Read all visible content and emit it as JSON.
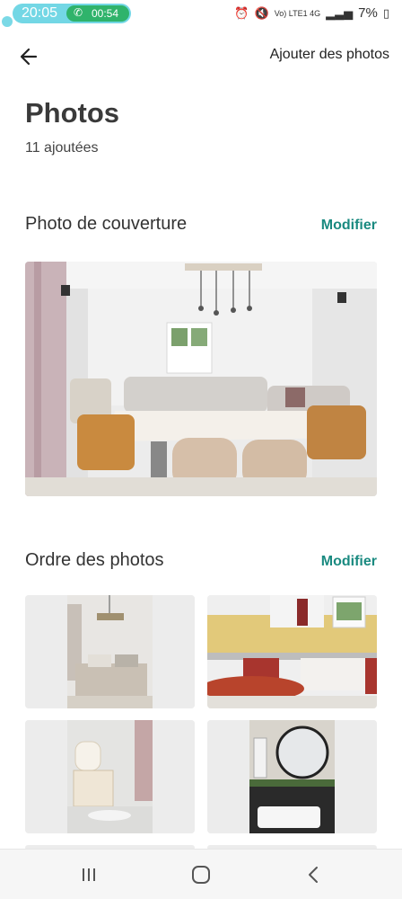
{
  "status_bar": {
    "time": "20:05",
    "call_duration": "00:54",
    "battery": "7%",
    "network": "Vo) LTE1 4G"
  },
  "header": {
    "add_photos_label": "Ajouter des photos"
  },
  "main": {
    "title": "Photos",
    "added_count": "11 ajoutées",
    "cover_section": {
      "title": "Photo de couverture",
      "modify_label": "Modifier"
    },
    "order_section": {
      "title": "Ordre des photos",
      "modify_label": "Modifier"
    }
  },
  "colors": {
    "accent": "#1a8a80",
    "call_chip": "#2fb36b"
  },
  "icons": {
    "back": "arrow-left-icon",
    "recents": "recents-icon",
    "home": "home-icon",
    "nav_back": "chevron-left-icon"
  }
}
